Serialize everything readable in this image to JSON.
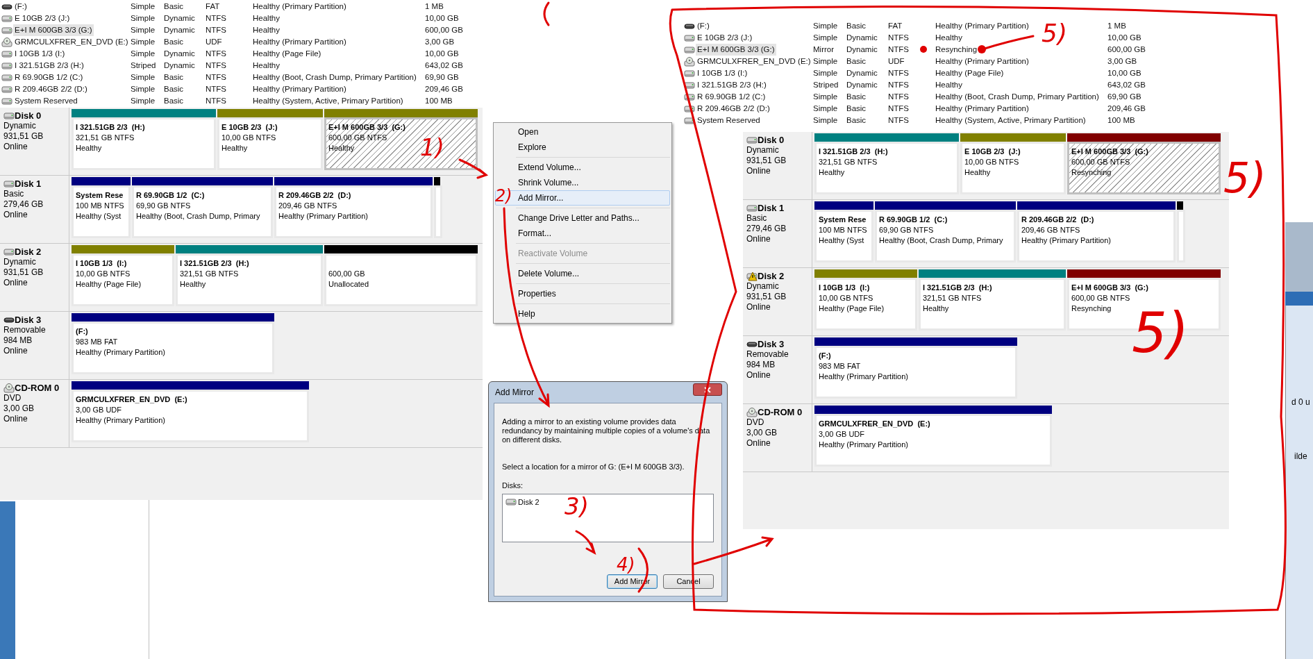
{
  "left_panel": {
    "volumes": [
      {
        "kind": "removable",
        "name": "(F:)",
        "layout": "Simple",
        "type": "Basic",
        "fs": "FAT",
        "status": "Healthy (Primary Partition)",
        "capacity": "1 MB",
        "selected": false
      },
      {
        "kind": "disk",
        "name": "E 10GB 2/3 (J:)",
        "layout": "Simple",
        "type": "Dynamic",
        "fs": "NTFS",
        "status": "Healthy",
        "capacity": "10,00 GB",
        "selected": false
      },
      {
        "kind": "disk",
        "name": "E+I M 600GB 3/3 (G:)",
        "layout": "Simple",
        "type": "Dynamic",
        "fs": "NTFS",
        "status": "Healthy",
        "capacity": "600,00 GB",
        "selected": true
      },
      {
        "kind": "dvd",
        "name": "GRMCULXFRER_EN_DVD (E:)",
        "layout": "Simple",
        "type": "Basic",
        "fs": "UDF",
        "status": "Healthy (Primary Partition)",
        "capacity": "3,00 GB",
        "selected": false
      },
      {
        "kind": "disk",
        "name": "I 10GB 1/3 (I:)",
        "layout": "Simple",
        "type": "Dynamic",
        "fs": "NTFS",
        "status": "Healthy (Page File)",
        "capacity": "10,00 GB",
        "selected": false
      },
      {
        "kind": "disk",
        "name": "I 321.51GB 2/3 (H:)",
        "layout": "Striped",
        "type": "Dynamic",
        "fs": "NTFS",
        "status": "Healthy",
        "capacity": "643,02 GB",
        "selected": false
      },
      {
        "kind": "disk",
        "name": "R 69.90GB 1/2 (C:)",
        "layout": "Simple",
        "type": "Basic",
        "fs": "NTFS",
        "status": "Healthy (Boot, Crash Dump, Primary Partition)",
        "capacity": "69,90 GB",
        "selected": false
      },
      {
        "kind": "disk",
        "name": "R 209.46GB 2/2 (D:)",
        "layout": "Simple",
        "type": "Basic",
        "fs": "NTFS",
        "status": "Healthy (Primary Partition)",
        "capacity": "209,46 GB",
        "selected": false
      },
      {
        "kind": "disk",
        "name": "System Reserved",
        "layout": "Simple",
        "type": "Basic",
        "fs": "NTFS",
        "status": "Healthy (System, Active, Primary Partition)",
        "capacity": "100 MB",
        "selected": false
      }
    ],
    "disks": [
      {
        "kind": "disk",
        "warning": false,
        "name": "Disk 0",
        "type": "Dynamic",
        "size": "931,51 GB",
        "status": "Online",
        "partitions": [
          {
            "color": "#008080",
            "title": "I 321.51GB 2/3  (H:)",
            "detail": "321,51 GB NTFS",
            "status": "Healthy",
            "selected": false
          },
          {
            "color": "#808000",
            "title": "E 10GB 2/3  (J:)",
            "detail": "10,00 GB NTFS",
            "status": "Healthy",
            "selected": false
          },
          {
            "color": "#808000",
            "title": "E+I M 600GB 3/3  (G:)",
            "detail": "600,00 GB NTFS",
            "status": "Healthy",
            "selected": true
          }
        ]
      },
      {
        "kind": "disk",
        "warning": false,
        "name": "Disk 1",
        "type": "Basic",
        "size": "279,46 GB",
        "status": "Online",
        "partitions": [
          {
            "color": "#000080",
            "title": "System Rese",
            "detail": "100 MB NTFS",
            "status": "Healthy (Syst",
            "selected": false
          },
          {
            "color": "#000080",
            "title": "R 69.90GB 1/2  (C:)",
            "detail": "69,90 GB NTFS",
            "status": "Healthy (Boot, Crash Dump, Primary",
            "selected": false
          },
          {
            "color": "#000080",
            "title": "R 209.46GB 2/2  (D:)",
            "detail": "209,46 GB NTFS",
            "status": "Healthy (Primary Partition)",
            "selected": false
          },
          {
            "color": "#000000",
            "selected": false
          }
        ]
      },
      {
        "kind": "disk",
        "warning": false,
        "name": "Disk 2",
        "type": "Dynamic",
        "size": "931,51 GB",
        "status": "Online",
        "partitions": [
          {
            "color": "#808000",
            "title": "I 10GB 1/3  (I:)",
            "detail": "10,00 GB NTFS",
            "status": "Healthy (Page File)",
            "selected": false
          },
          {
            "color": "#008080",
            "title": "I 321.51GB 2/3  (H:)",
            "detail": "321,51 GB NTFS",
            "status": "Healthy",
            "selected": false
          },
          {
            "color": "#000000",
            "detail": "600,00 GB",
            "status": "Unallocated",
            "selected": false
          }
        ]
      },
      {
        "kind": "removable",
        "warning": false,
        "name": "Disk 3",
        "type": "Removable",
        "size": "984 MB",
        "status": "Online",
        "partitions": [
          {
            "color": "#000080",
            "title": "(F:)",
            "detail": "983 MB FAT",
            "status": "Healthy (Primary Partition)",
            "selected": false
          }
        ]
      },
      {
        "kind": "dvd",
        "warning": false,
        "name": "CD-ROM 0",
        "type": "DVD",
        "size": "3,00 GB",
        "status": "Online",
        "partitions": [
          {
            "color": "#000080",
            "title": "GRMCULXFRER_EN_DVD  (E:)",
            "detail": "3,00 GB UDF",
            "status": "Healthy (Primary Partition)",
            "selected": false
          }
        ]
      }
    ]
  },
  "context_menu": {
    "groups": [
      [
        {
          "label": "Open",
          "disabled": false,
          "selected": false
        },
        {
          "label": "Explore",
          "disabled": false,
          "selected": false
        }
      ],
      [
        {
          "label": "Extend Volume...",
          "disabled": false,
          "selected": false
        },
        {
          "label": "Shrink Volume...",
          "disabled": false,
          "selected": false
        },
        {
          "label": "Add Mirror...",
          "disabled": false,
          "selected": true
        }
      ],
      [
        {
          "label": "Change Drive Letter and Paths...",
          "disabled": false,
          "selected": false
        },
        {
          "label": "Format...",
          "disabled": false,
          "selected": false
        }
      ],
      [
        {
          "label": "Reactivate Volume",
          "disabled": true,
          "selected": false
        }
      ],
      [
        {
          "label": "Delete Volume...",
          "disabled": false,
          "selected": false
        }
      ],
      [
        {
          "label": "Properties",
          "disabled": false,
          "selected": false
        }
      ],
      [
        {
          "label": "Help",
          "disabled": false,
          "selected": false
        }
      ]
    ]
  },
  "dialog": {
    "title": "Add Mirror",
    "description": "Adding a mirror to an existing volume provides data redundancy by maintaining multiple copies of a volume's data on different disks.",
    "prompt": "Select a location for a mirror of G: (E+I M 600GB 3/3).",
    "list_label": "Disks:",
    "disks": [
      {
        "label": "Disk 2",
        "selected": false
      }
    ],
    "buttons": [
      {
        "label": "Add Mirror",
        "default": true
      },
      {
        "label": "Cancel",
        "default": false
      }
    ]
  },
  "right_panel": {
    "volumes": [
      {
        "kind": "removable",
        "name": "(F:)",
        "layout": "Simple",
        "type": "Basic",
        "fs": "FAT",
        "status": "Healthy (Primary Partition)",
        "capacity": "1 MB",
        "selected": false
      },
      {
        "kind": "disk",
        "name": "E 10GB 2/3 (J:)",
        "layout": "Simple",
        "type": "Dynamic",
        "fs": "NTFS",
        "status": "Healthy",
        "capacity": "10,00 GB",
        "selected": false
      },
      {
        "kind": "disk",
        "name": "E+I M 600GB 3/3 (G:)",
        "layout": "Mirror",
        "type": "Dynamic",
        "fs": "NTFS",
        "status": "Resynching",
        "capacity": "600,00 GB",
        "selected": true
      },
      {
        "kind": "dvd",
        "name": "GRMCULXFRER_EN_DVD (E:)",
        "layout": "Simple",
        "type": "Basic",
        "fs": "UDF",
        "status": "Healthy (Primary Partition)",
        "capacity": "3,00 GB",
        "selected": false
      },
      {
        "kind": "disk",
        "name": "I 10GB 1/3 (I:)",
        "layout": "Simple",
        "type": "Dynamic",
        "fs": "NTFS",
        "status": "Healthy (Page File)",
        "capacity": "10,00 GB",
        "selected": false
      },
      {
        "kind": "disk",
        "name": "I 321.51GB 2/3 (H:)",
        "layout": "Striped",
        "type": "Dynamic",
        "fs": "NTFS",
        "status": "Healthy",
        "capacity": "643,02 GB",
        "selected": false
      },
      {
        "kind": "disk",
        "name": "R 69.90GB 1/2 (C:)",
        "layout": "Simple",
        "type": "Basic",
        "fs": "NTFS",
        "status": "Healthy (Boot, Crash Dump, Primary Partition)",
        "capacity": "69,90 GB",
        "selected": false
      },
      {
        "kind": "disk",
        "name": "R 209.46GB 2/2 (D:)",
        "layout": "Simple",
        "type": "Basic",
        "fs": "NTFS",
        "status": "Healthy (Primary Partition)",
        "capacity": "209,46 GB",
        "selected": false
      },
      {
        "kind": "disk",
        "name": "System Reserved",
        "layout": "Simple",
        "type": "Basic",
        "fs": "NTFS",
        "status": "Healthy (System, Active, Primary Partition)",
        "capacity": "100 MB",
        "selected": false
      }
    ],
    "disks": [
      {
        "kind": "disk",
        "warning": false,
        "name": "Disk 0",
        "type": "Dynamic",
        "size": "931,51 GB",
        "status": "Online",
        "partitions": [
          {
            "color": "#008080",
            "title": "I 321.51GB 2/3  (H:)",
            "detail": "321,51 GB NTFS",
            "status": "Healthy",
            "selected": false
          },
          {
            "color": "#808000",
            "title": "E 10GB 2/3  (J:)",
            "detail": "10,00 GB NTFS",
            "status": "Healthy",
            "selected": false
          },
          {
            "color": "#800000",
            "title": "E+I M 600GB 3/3  (G:)",
            "detail": "600,00 GB NTFS",
            "status": "Resynching",
            "selected": true
          }
        ]
      },
      {
        "kind": "disk",
        "warning": false,
        "name": "Disk 1",
        "type": "Basic",
        "size": "279,46 GB",
        "status": "Online",
        "partitions": [
          {
            "color": "#000080",
            "title": "System Rese",
            "detail": "100 MB NTFS",
            "status": "Healthy (Syst",
            "selected": false
          },
          {
            "color": "#000080",
            "title": "R 69.90GB 1/2  (C:)",
            "detail": "69,90 GB NTFS",
            "status": "Healthy (Boot, Crash Dump, Primary",
            "selected": false
          },
          {
            "color": "#000080",
            "title": "R 209.46GB 2/2  (D:)",
            "detail": "209,46 GB NTFS",
            "status": "Healthy (Primary Partition)",
            "selected": false
          },
          {
            "color": "#000000",
            "selected": false
          }
        ]
      },
      {
        "kind": "disk",
        "warning": true,
        "name": "Disk 2",
        "type": "Dynamic",
        "size": "931,51 GB",
        "status": "Online",
        "partitions": [
          {
            "color": "#808000",
            "title": "I 10GB 1/3  (I:)",
            "detail": "10,00 GB NTFS",
            "status": "Healthy (Page File)",
            "selected": false
          },
          {
            "color": "#008080",
            "title": "I 321.51GB 2/3  (H:)",
            "detail": "321,51 GB NTFS",
            "status": "Healthy",
            "selected": false
          },
          {
            "color": "#800000",
            "title": "E+I M 600GB 3/3  (G:)",
            "detail": "600,00 GB NTFS",
            "status": "Resynching",
            "selected": false
          }
        ]
      },
      {
        "kind": "removable",
        "warning": false,
        "name": "Disk 3",
        "type": "Removable",
        "size": "984 MB",
        "status": "Online",
        "partitions": [
          {
            "color": "#000080",
            "title": "(F:)",
            "detail": "983 MB FAT",
            "status": "Healthy (Primary Partition)",
            "selected": false
          }
        ]
      },
      {
        "kind": "dvd",
        "warning": false,
        "name": "CD-ROM 0",
        "type": "DVD",
        "size": "3,00 GB",
        "status": "Online",
        "partitions": [
          {
            "color": "#000080",
            "title": "GRMCULXFRER_EN_DVD  (E:)",
            "detail": "3,00 GB UDF",
            "status": "Healthy (Primary Partition)",
            "selected": false
          }
        ]
      }
    ]
  },
  "background_window": {
    "texts": [
      "d 0 u",
      "ilde"
    ]
  },
  "annotations": [
    {
      "label": "1)"
    },
    {
      "label": "2)"
    },
    {
      "label": "3)"
    },
    {
      "label": "4)"
    },
    {
      "label": "5)"
    },
    {
      "label": "5)"
    },
    {
      "label": "5)"
    }
  ]
}
